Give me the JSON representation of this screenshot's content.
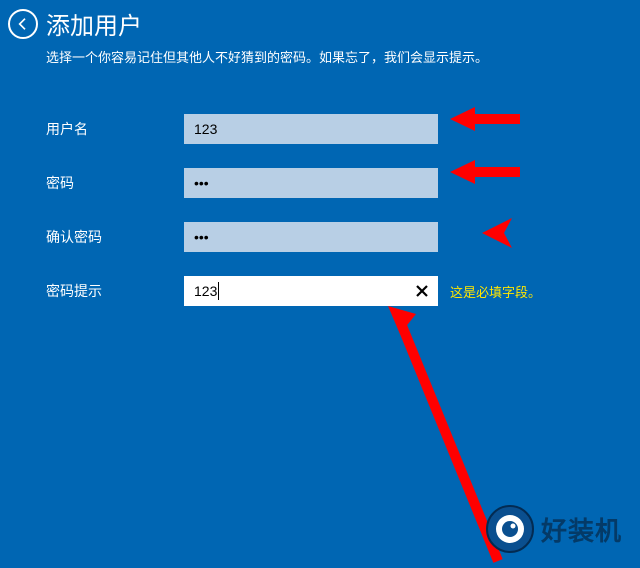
{
  "header": {
    "title": "添加用户",
    "subtitle": "选择一个你容易记住但其他人不好猜到的密码。如果忘了，我们会显示提示。"
  },
  "form": {
    "username_label": "用户名",
    "username_value": "123",
    "password_label": "密码",
    "password_value": "•••",
    "confirm_label": "确认密码",
    "confirm_value": "•••",
    "hint_label": "密码提示",
    "hint_value": "123",
    "required_message": "这是必填字段。"
  },
  "logo": {
    "text": "好装机"
  }
}
